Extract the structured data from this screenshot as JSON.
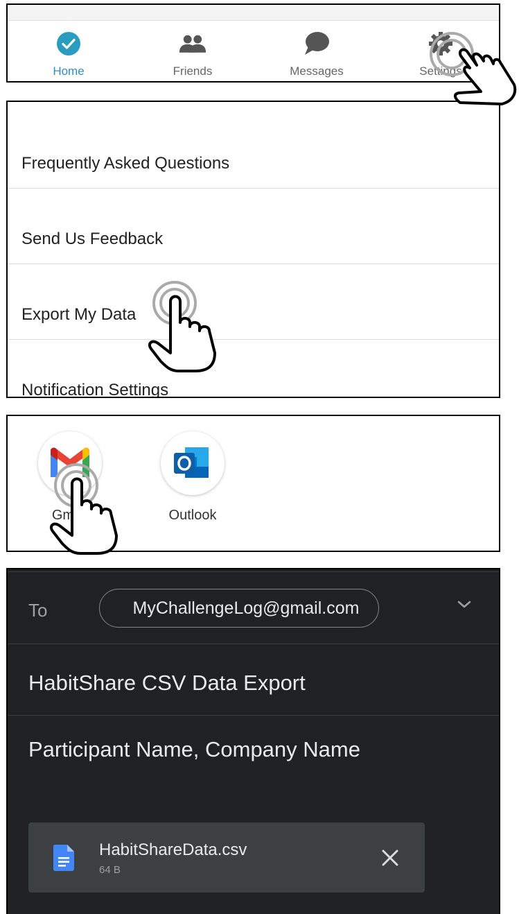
{
  "nav": {
    "items": [
      {
        "label": "Home",
        "icon": "check-circle-icon"
      },
      {
        "label": "Friends",
        "icon": "people-icon"
      },
      {
        "label": "Messages",
        "icon": "chat-bubble-icon"
      },
      {
        "label": "Settings",
        "icon": "gear-icon"
      }
    ],
    "active_color": "#2f8ec1"
  },
  "settings_list": {
    "items": [
      "Frequently Asked Questions",
      "Send Us Feedback",
      "Export My Data",
      "Notification Settings"
    ]
  },
  "share": {
    "apps": [
      {
        "label": "Gmail",
        "icon": "gmail-icon"
      },
      {
        "label": "Outlook",
        "icon": "outlook-icon"
      }
    ]
  },
  "compose": {
    "to_label": "To",
    "recipient": "MyChallengeLog@gmail.com",
    "subject": "HabitShare CSV Data Export",
    "body": "Participant Name, Company Name",
    "attachment": {
      "name": "HabitShareData.csv",
      "size": "64 B"
    },
    "background": "#202124"
  }
}
